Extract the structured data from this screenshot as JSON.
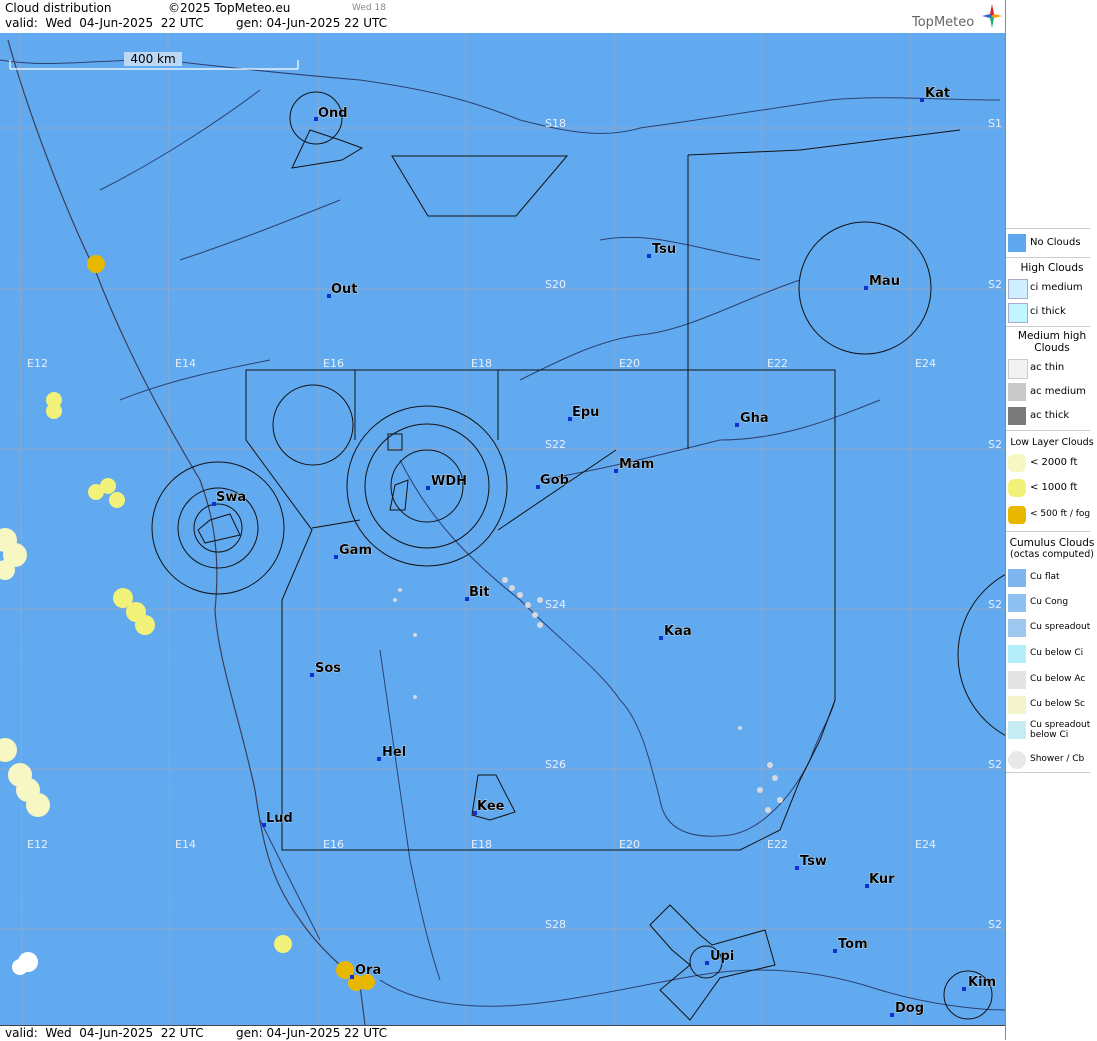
{
  "header": {
    "title": "Cloud distribution",
    "copyright": "©2025 TopMeteo.eu",
    "day_tag": "Wed 18",
    "valid_line": "valid:  Wed  04-Jun-2025  22 UTC",
    "gen_line": "gen: 04-Jun-2025 22 UTC",
    "logo": "TopMeteo"
  },
  "footer": {
    "valid_line": "valid:  Wed  04-Jun-2025  22 UTC",
    "gen_line": "gen: 04-Jun-2025 22 UTC"
  },
  "scale_bar": {
    "label": "400 km"
  },
  "grid_labels": {
    "lon": [
      "E12",
      "E14",
      "E16",
      "E18",
      "E20",
      "E22",
      "E24"
    ],
    "lat": [
      "S18",
      "S20",
      "S22",
      "S24",
      "S26",
      "S28"
    ],
    "edge": "S2",
    "edge_top": "S1"
  },
  "cities": [
    {
      "name": "Ond"
    },
    {
      "name": "Kat"
    },
    {
      "name": "Tsu"
    },
    {
      "name": "Mau"
    },
    {
      "name": "Out"
    },
    {
      "name": "Epu"
    },
    {
      "name": "Gha"
    },
    {
      "name": "Mam"
    },
    {
      "name": "WDH"
    },
    {
      "name": "Gob"
    },
    {
      "name": "Swa"
    },
    {
      "name": "Gam"
    },
    {
      "name": "Bit"
    },
    {
      "name": "Kaa"
    },
    {
      "name": "Sos"
    },
    {
      "name": "Hel"
    },
    {
      "name": "Lud"
    },
    {
      "name": "Kee"
    },
    {
      "name": "Tsw"
    },
    {
      "name": "Kur"
    },
    {
      "name": "Tom"
    },
    {
      "name": "Upi"
    },
    {
      "name": "Ora"
    },
    {
      "name": "Kim"
    },
    {
      "name": "Dog"
    }
  ],
  "legend": {
    "no_clouds": "No Clouds",
    "high_header": "High Clouds",
    "ci_medium": "ci medium",
    "ci_thick": "ci thick",
    "medium_header": "Medium high Clouds",
    "ac_thin": "ac thin",
    "ac_medium": "ac medium",
    "ac_thick": "ac thick",
    "low_header": "Low Layer Clouds",
    "low_2000": "< 2000 ft",
    "low_1000": "< 1000 ft",
    "low_500": "< 500 ft / fog",
    "cu_header": "Cumulus Clouds",
    "cu_sub": "(octas computed)",
    "cu_flat": "Cu flat",
    "cu_cong": "Cu Cong",
    "cu_spreadout": "Cu spreadout",
    "cu_below_ci": "Cu below Ci",
    "cu_below_ac": "Cu below Ac",
    "cu_below_sc": "Cu below Sc",
    "cu_spreadout_below_ci": "Cu spreadout below Ci",
    "shower_cb": "Shower / Cb"
  },
  "colors": {
    "map_bg": "#62aaf0",
    "no_clouds": "#5fa8f0",
    "low_2000": "#f6f7c2",
    "low_1000": "#f2f27a",
    "low_500": "#e8b800",
    "ac_medium": "#c9c9c9",
    "ac_thick": "#7a7a7a"
  }
}
